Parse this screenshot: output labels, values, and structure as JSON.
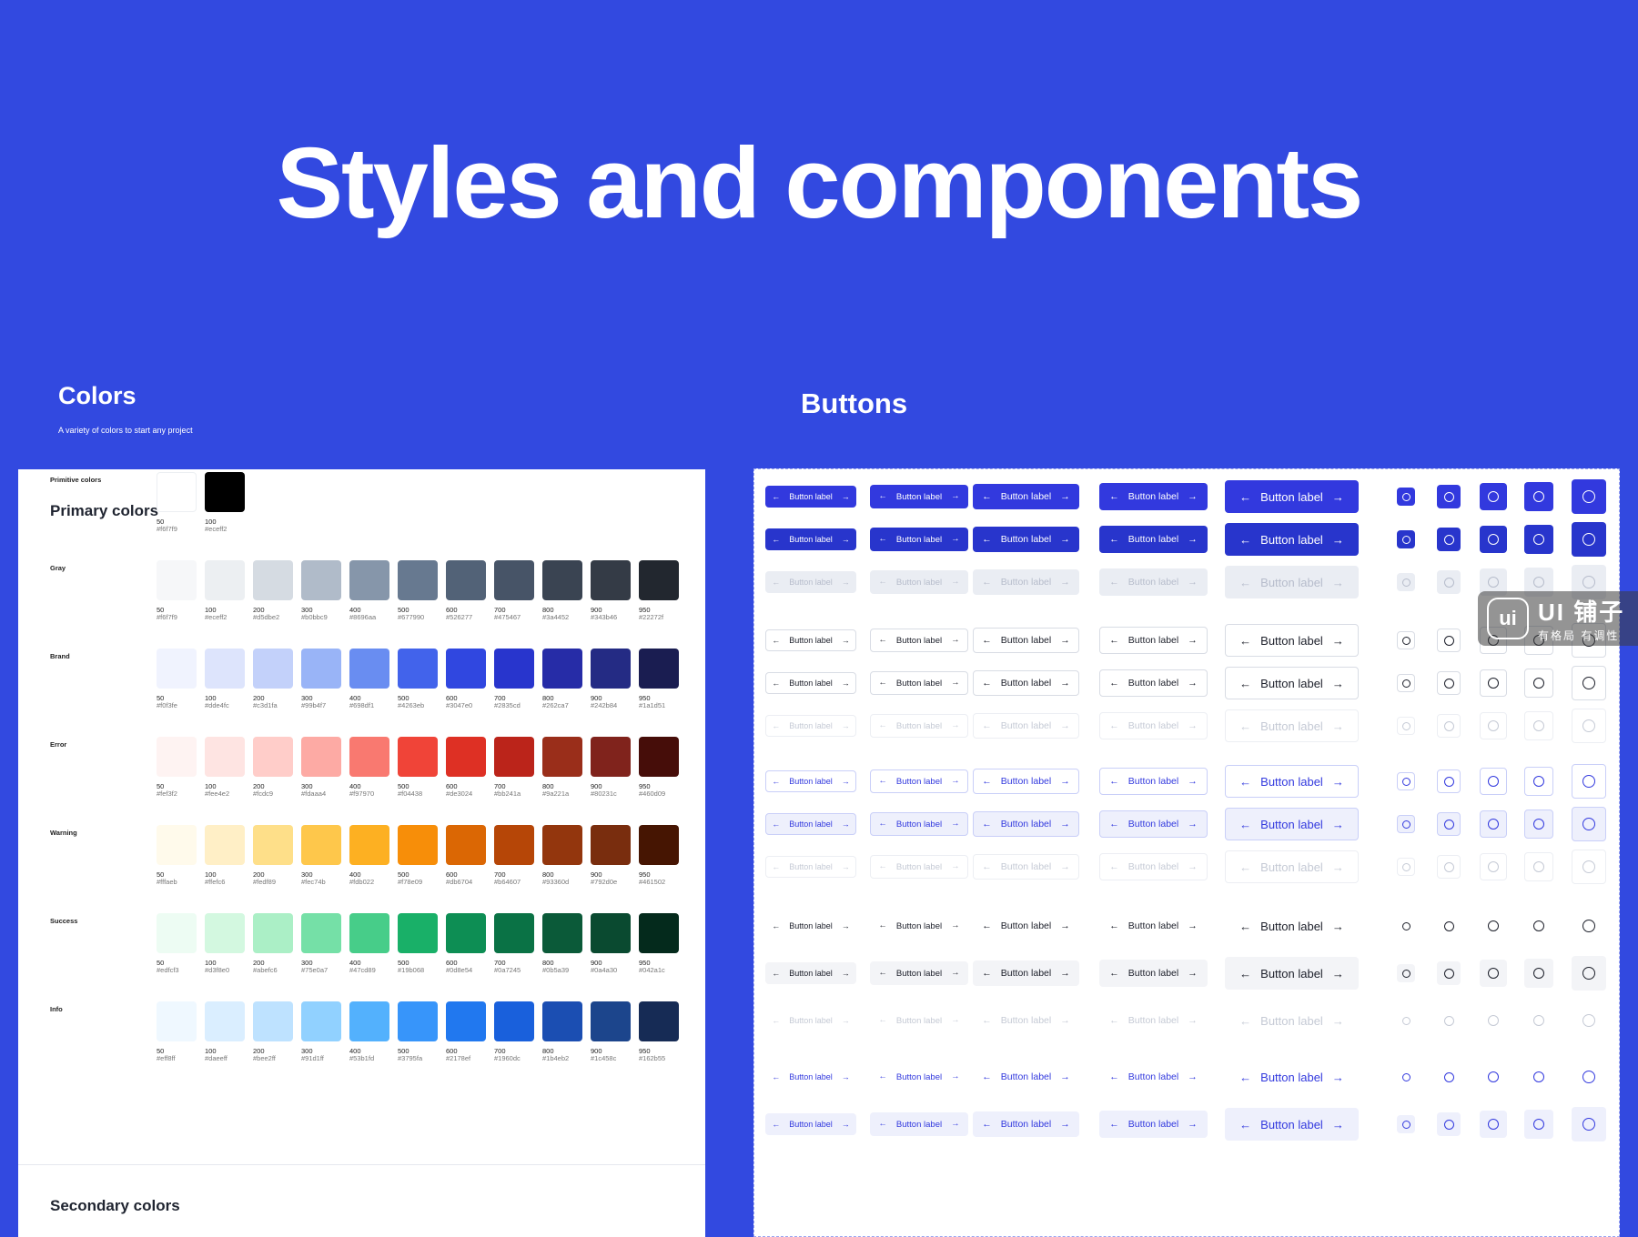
{
  "hero": {
    "title": "Styles and components"
  },
  "colors_panel": {
    "title": "Colors",
    "subtitle": "A variety of colors to start any project",
    "primary_title": "Primary colors",
    "secondary_title": "Secondary colors",
    "rows": [
      {
        "label": "Primitive colors",
        "swatches": [
          {
            "step": "50",
            "hex": "#f6f7f9",
            "color": "#ffffff"
          },
          {
            "step": "100",
            "hex": "#eceff2",
            "color": "#000000"
          }
        ]
      },
      {
        "label": "Gray",
        "swatches": [
          {
            "step": "50",
            "hex": "#f6f7f9",
            "color": "#f6f7f9"
          },
          {
            "step": "100",
            "hex": "#eceff2",
            "color": "#eceff2"
          },
          {
            "step": "200",
            "hex": "#d5dbe2",
            "color": "#d5dbe2"
          },
          {
            "step": "300",
            "hex": "#b0bbc9",
            "color": "#b0bbc9"
          },
          {
            "step": "400",
            "hex": "#8696aa",
            "color": "#8696aa"
          },
          {
            "step": "500",
            "hex": "#677990",
            "color": "#677990"
          },
          {
            "step": "600",
            "hex": "#526277",
            "color": "#526277"
          },
          {
            "step": "700",
            "hex": "#475467",
            "color": "#475467"
          },
          {
            "step": "800",
            "hex": "#3a4452",
            "color": "#3a4452"
          },
          {
            "step": "900",
            "hex": "#343b46",
            "color": "#343b46"
          },
          {
            "step": "950",
            "hex": "#22272f",
            "color": "#22272f"
          }
        ]
      },
      {
        "label": "Brand",
        "swatches": [
          {
            "step": "50",
            "hex": "#f0f3fe",
            "color": "#f0f3fe"
          },
          {
            "step": "100",
            "hex": "#dde4fc",
            "color": "#dde4fc"
          },
          {
            "step": "200",
            "hex": "#c3d1fa",
            "color": "#c3d1fa"
          },
          {
            "step": "300",
            "hex": "#99b4f7",
            "color": "#99b4f7"
          },
          {
            "step": "400",
            "hex": "#698df1",
            "color": "#698df1"
          },
          {
            "step": "500",
            "hex": "#4263eb",
            "color": "#4263eb"
          },
          {
            "step": "600",
            "hex": "#3047e0",
            "color": "#3047e0"
          },
          {
            "step": "700",
            "hex": "#2835cd",
            "color": "#2835cd"
          },
          {
            "step": "800",
            "hex": "#262ca7",
            "color": "#262ca7"
          },
          {
            "step": "900",
            "hex": "#242b84",
            "color": "#242b84"
          },
          {
            "step": "950",
            "hex": "#1a1d51",
            "color": "#1a1d51"
          }
        ]
      },
      {
        "label": "Error",
        "swatches": [
          {
            "step": "50",
            "hex": "#fef3f2",
            "color": "#fef3f2"
          },
          {
            "step": "100",
            "hex": "#fee4e2",
            "color": "#fee4e2"
          },
          {
            "step": "200",
            "hex": "#fcdc9",
            "color": "#ffcdc9"
          },
          {
            "step": "300",
            "hex": "#fdaaa4",
            "color": "#fdaaa4"
          },
          {
            "step": "400",
            "hex": "#f97970",
            "color": "#f97970"
          },
          {
            "step": "500",
            "hex": "#f04438",
            "color": "#f04438"
          },
          {
            "step": "600",
            "hex": "#de3024",
            "color": "#de3024"
          },
          {
            "step": "700",
            "hex": "#bb241a",
            "color": "#bb241a"
          },
          {
            "step": "800",
            "hex": "#9a221a",
            "color": "#9a2e1a"
          },
          {
            "step": "900",
            "hex": "#80231c",
            "color": "#80231c"
          },
          {
            "step": "950",
            "hex": "#460d09",
            "color": "#460d09"
          }
        ]
      },
      {
        "label": "Warning",
        "swatches": [
          {
            "step": "50",
            "hex": "#fffaeb",
            "color": "#fffaeb"
          },
          {
            "step": "100",
            "hex": "#ffefc6",
            "color": "#ffefc6"
          },
          {
            "step": "200",
            "hex": "#fedf89",
            "color": "#fedf89"
          },
          {
            "step": "300",
            "hex": "#fec74b",
            "color": "#fec74b"
          },
          {
            "step": "400",
            "hex": "#fdb022",
            "color": "#fdb022"
          },
          {
            "step": "500",
            "hex": "#f78e09",
            "color": "#f78e09"
          },
          {
            "step": "600",
            "hex": "#db6704",
            "color": "#db6704"
          },
          {
            "step": "700",
            "hex": "#b64607",
            "color": "#b64607"
          },
          {
            "step": "800",
            "hex": "#93360d",
            "color": "#93360d"
          },
          {
            "step": "900",
            "hex": "#792d0e",
            "color": "#792d0e"
          },
          {
            "step": "950",
            "hex": "#461502",
            "color": "#461502"
          }
        ]
      },
      {
        "label": "Success",
        "swatches": [
          {
            "step": "50",
            "hex": "#edfcf3",
            "color": "#edfcf3"
          },
          {
            "step": "100",
            "hex": "#d3f8e0",
            "color": "#d3f8e0"
          },
          {
            "step": "200",
            "hex": "#abefc6",
            "color": "#abefc6"
          },
          {
            "step": "300",
            "hex": "#75e0a7",
            "color": "#75e0a7"
          },
          {
            "step": "400",
            "hex": "#47cd89",
            "color": "#47cd89"
          },
          {
            "step": "500",
            "hex": "#19b068",
            "color": "#19b068"
          },
          {
            "step": "600",
            "hex": "#0d8e54",
            "color": "#0d8e54"
          },
          {
            "step": "700",
            "hex": "#0a7245",
            "color": "#0a7245"
          },
          {
            "step": "800",
            "hex": "#0b5a39",
            "color": "#0b5a39"
          },
          {
            "step": "900",
            "hex": "#0a4a30",
            "color": "#0a4a30"
          },
          {
            "step": "950",
            "hex": "#042a1c",
            "color": "#042a1c"
          }
        ]
      },
      {
        "label": "Info",
        "swatches": [
          {
            "step": "50",
            "hex": "#eff8ff",
            "color": "#eff8ff"
          },
          {
            "step": "100",
            "hex": "#daeeff",
            "color": "#daeeff"
          },
          {
            "step": "200",
            "hex": "#bee2ff",
            "color": "#bee2ff"
          },
          {
            "step": "300",
            "hex": "#91d1ff",
            "color": "#91d1ff"
          },
          {
            "step": "400",
            "hex": "#53b1fd",
            "color": "#53b1fd"
          },
          {
            "step": "500",
            "hex": "#3795fa",
            "color": "#3795fa"
          },
          {
            "step": "600",
            "hex": "#2178ef",
            "color": "#2178ef"
          },
          {
            "step": "700",
            "hex": "#1960dc",
            "color": "#1960dc"
          },
          {
            "step": "800",
            "hex": "#1b4eb2",
            "color": "#1b4eb2"
          },
          {
            "step": "900",
            "hex": "#1c458c",
            "color": "#1c458c"
          },
          {
            "step": "950",
            "hex": "#162b55",
            "color": "#162b55"
          }
        ]
      }
    ]
  },
  "buttons_panel": {
    "title": "Buttons",
    "button_label": "Button label",
    "arrow_left": "←",
    "arrow_right": "→",
    "rows": [
      {
        "style": "primary",
        "state": "default"
      },
      {
        "style": "primary",
        "state": "hover"
      },
      {
        "style": "primary",
        "state": "disabled"
      },
      {
        "style": "secondary-gray",
        "state": "default"
      },
      {
        "style": "secondary-gray",
        "state": "hover"
      },
      {
        "style": "secondary-gray",
        "state": "disabled"
      },
      {
        "style": "secondary-brand",
        "state": "default"
      },
      {
        "style": "secondary-brand",
        "state": "hover"
      },
      {
        "style": "secondary-brand",
        "state": "disabled"
      },
      {
        "style": "tertiary-gray",
        "state": "default"
      },
      {
        "style": "tertiary-gray",
        "state": "hover"
      },
      {
        "style": "tertiary-gray",
        "state": "disabled"
      },
      {
        "style": "tertiary-brand",
        "state": "default"
      },
      {
        "style": "tertiary-brand",
        "state": "hover"
      }
    ]
  },
  "watermark": {
    "logo": "ui",
    "name": "UI 铺子",
    "tagline": "有格局 有调性"
  }
}
